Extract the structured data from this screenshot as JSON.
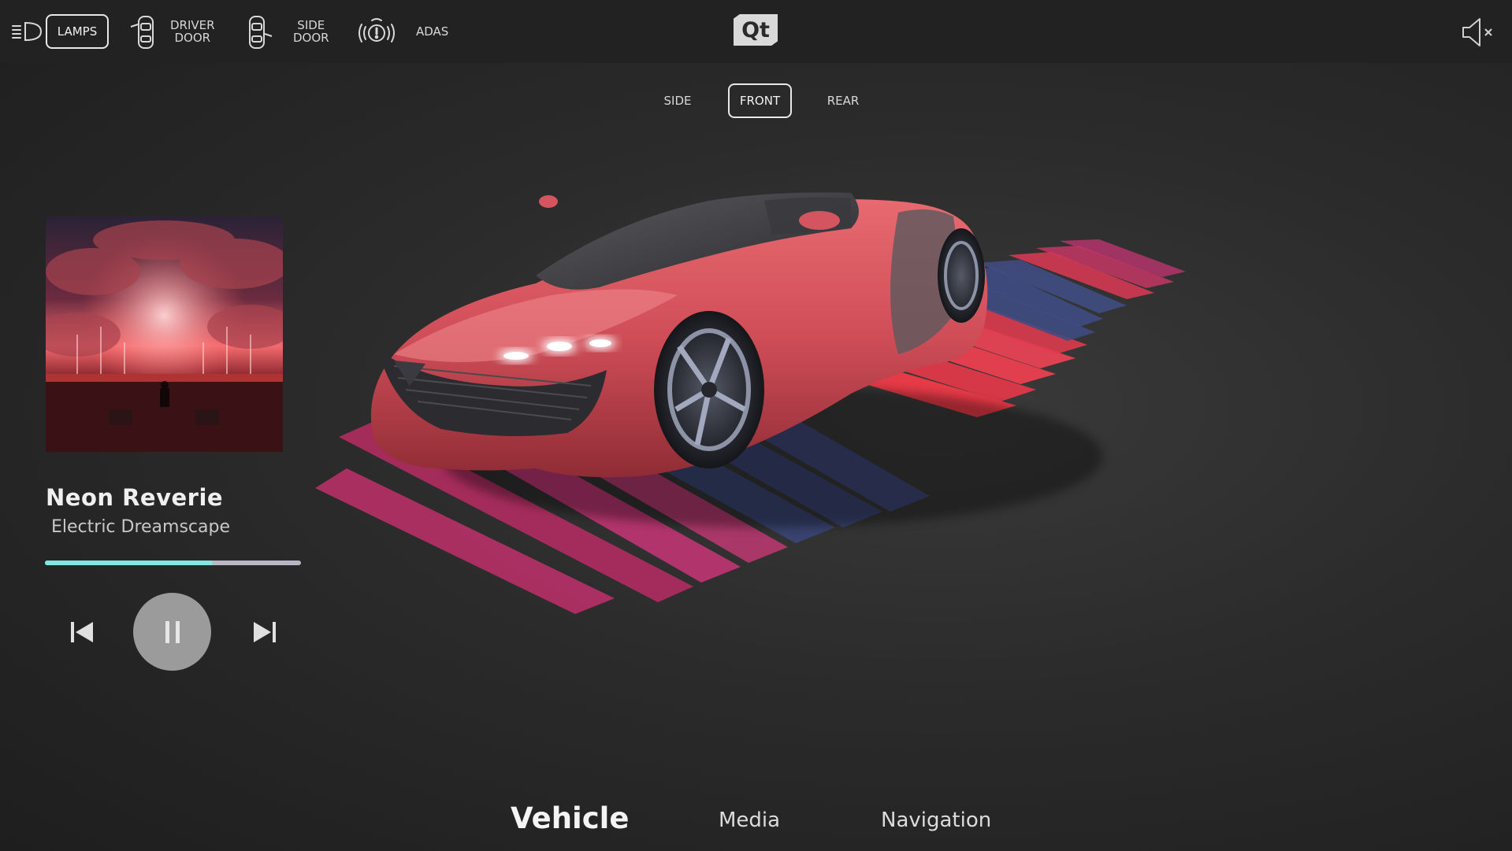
{
  "topbar": {
    "lamps_label": "LAMPS",
    "driver_door_line1": "DRIVER",
    "driver_door_line2": "DOOR",
    "side_door_line1": "SIDE",
    "side_door_line2": "DOOR",
    "adas_label": "ADAS",
    "logo_text": "Qt",
    "icons": [
      "headlamp-icon",
      "driver-door-icon",
      "side-door-icon",
      "adas-icon",
      "speaker-muted-icon"
    ]
  },
  "view_tabs": [
    {
      "label": "SIDE",
      "active": false
    },
    {
      "label": "FRONT",
      "active": true
    },
    {
      "label": "REAR",
      "active": false
    }
  ],
  "media_player": {
    "title": "Neon Reverie",
    "artist": "Electric Dreamscape",
    "progress": 0.655,
    "state": "playing",
    "colors": {
      "progress_fill": "#83e6e2",
      "progress_track": "#b9b7c6"
    }
  },
  "bottom_nav": [
    {
      "label": "Vehicle",
      "active": true
    },
    {
      "label": "Media",
      "active": false
    },
    {
      "label": "Navigation",
      "active": false
    }
  ],
  "colors": {
    "car_body": "#d94f5a",
    "neon_red": "#ff3b4a",
    "neon_pink": "#e8357a",
    "neon_blue": "#3f4f8a",
    "background": "#2b2b2b"
  }
}
